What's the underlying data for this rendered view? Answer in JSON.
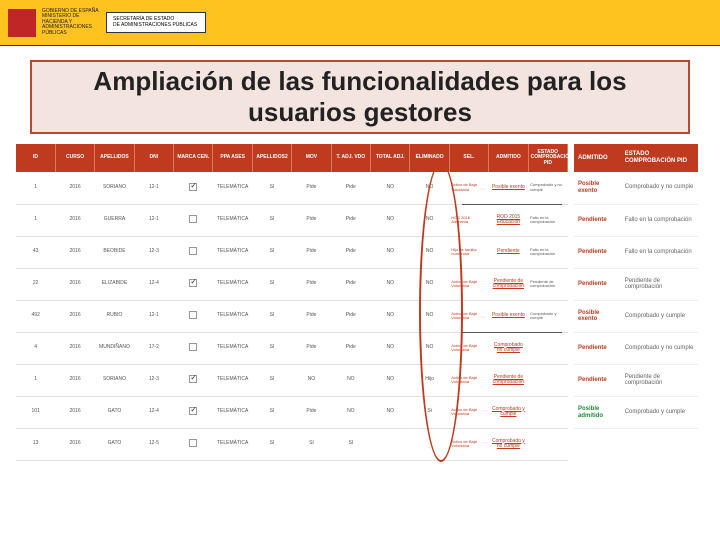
{
  "banner": {
    "flag": "ES",
    "ministry1": "GOBIERNO DE ESPAÑA",
    "ministry2": "MINISTERIO DE HACIENDA Y ADMINISTRACIONES PÚBLICAS",
    "secretaria1": "SECRETARÍA DE ESTADO",
    "secretaria2": "DE ADMINISTRACIONES PÚBLICAS"
  },
  "title": "Ampliación de las funcionalidades para los usuarios gestores",
  "main": {
    "headers": [
      "ID",
      "CURSO",
      "APELLIDOS",
      "DNI",
      "MARCA CEN.",
      "PPA ASES",
      "APELLIDOS2",
      "MOV",
      "T. ADJ. VDO",
      "TOTAL ADJ.",
      "ELIMINADO",
      "SEL.",
      "ADMITIDO",
      "ESTADO COMPROBACIÓN PID"
    ],
    "rows": [
      {
        "id": "1",
        "curso": "2016",
        "apel": "SORIANO",
        "dni": "12-1",
        "chk": true,
        "ppa": "TELEMÁTICA",
        "mov": "SI",
        "col8": "Pide",
        "tadj": "Pide",
        "total": "NO",
        "elim": "NO",
        "sel": "Activo de Baja Voluntaria",
        "adm": "Posible exento",
        "est": "Comprobado y no cumple"
      },
      {
        "id": "1",
        "curso": "2016",
        "apel": "GUERRA",
        "dni": "12-1",
        "chk": false,
        "ppa": "TELEMÁTICA",
        "mov": "SI",
        "col8": "Pide",
        "tadj": "Pide",
        "total": "NO",
        "elim": "NO",
        "sel": "HOS 2016 Alemania",
        "adm": "ROD 2015 Educación",
        "est": "Fallo en la comprobación"
      },
      {
        "id": "43",
        "curso": "2016",
        "apel": "BEOBIDE",
        "dni": "12-3",
        "chk": false,
        "ppa": "TELEMÁTICA",
        "mov": "SI",
        "col8": "Pide",
        "tadj": "Pide",
        "total": "NO",
        "elim": "NO",
        "sel": "Hijo de familia numerosa",
        "adm": "Pendiente",
        "est": "Fallo en la comprobación"
      },
      {
        "id": "22",
        "curso": "2016",
        "apel": "ELIZABIDE",
        "dni": "12-4",
        "chk": true,
        "ppa": "TELEMÁTICA",
        "mov": "SI",
        "col8": "Pide",
        "tadj": "Pide",
        "total": "NO",
        "elim": "NO",
        "sel": "Activo de Baja Voluntaria",
        "adm": "Pendiente de comprobación",
        "est": "Pendiente de comprobación"
      },
      {
        "id": "492",
        "curso": "2016",
        "apel": "RUBIO",
        "dni": "12-1",
        "chk": false,
        "ppa": "TELEMÁTICA",
        "mov": "SI",
        "col8": "Pide",
        "tadj": "Pide",
        "total": "NO",
        "elim": "NO",
        "sel": "Activo de Baja Voluntaria",
        "adm": "Posible exento",
        "est": "Comprobado y cumple"
      },
      {
        "id": "4",
        "curso": "2016",
        "apel": "MUNDIÑANO",
        "dni": "17-2",
        "chk": false,
        "ppa": "TELEMÁTICA",
        "mov": "SI",
        "col8": "Pide",
        "tadj": "Pide",
        "total": "NO",
        "elim": "NO",
        "sel": "Activo de Baja Voluntaria",
        "adm": "Comprobado no cumple",
        "est": ""
      },
      {
        "id": "1",
        "curso": "2016",
        "apel": "SORIANO",
        "dni": "12-3",
        "chk": true,
        "ppa": "TELEMÁTICA",
        "mov": "SI",
        "col8": "NO",
        "tadj": "NO",
        "total": "NO",
        "elim": "Hijo",
        "sel": "Activo de Baja Voluntaria",
        "adm": "Pendiente de comprobación",
        "est": ""
      },
      {
        "id": "101",
        "curso": "2016",
        "apel": "GATO",
        "dni": "12-4",
        "chk": true,
        "ppa": "TELEMÁTICA",
        "mov": "SI",
        "col8": "Pide",
        "tadj": "NO",
        "total": "NO",
        "elim": "Si",
        "sel": "Activo de Baja Voluntaria",
        "adm": "Comprobado y cumple",
        "est": ""
      },
      {
        "id": "13",
        "curso": "2016",
        "apel": "GATO",
        "dni": "12-5",
        "chk": false,
        "ppa": "TELEMÁTICA",
        "mov": "SI",
        "col8": "SI",
        "tadj": "SI",
        "total": "",
        "elim": "",
        "sel": "Activo de Baja Voluntaria",
        "adm": "Comprobado y no cumple",
        "est": ""
      }
    ]
  },
  "side": {
    "headers": [
      "ADMITIDO",
      "ESTADO COMPROBACIÓN PID"
    ],
    "rows": [
      {
        "adm": "Posible exento",
        "cls": "red",
        "est": "Comprobado y no cumple"
      },
      {
        "adm": "Pendiente",
        "cls": "red",
        "est": "Fallo en la comprobación"
      },
      {
        "adm": "Pendiente",
        "cls": "red",
        "est": "Fallo en la comprobación"
      },
      {
        "adm": "Pendiente",
        "cls": "red",
        "est": "Pendiente de comprobación"
      },
      {
        "adm": "Posible exento",
        "cls": "red",
        "est": "Comprobado y cumple"
      },
      {
        "adm": "Pendiente",
        "cls": "red",
        "est": "Comprobado y no cumple"
      },
      {
        "adm": "Pendiente",
        "cls": "red",
        "est": "Pendiente de comprobación"
      },
      {
        "adm": "Posible admitido",
        "cls": "green",
        "est": "Comprobado y cumple"
      }
    ]
  }
}
